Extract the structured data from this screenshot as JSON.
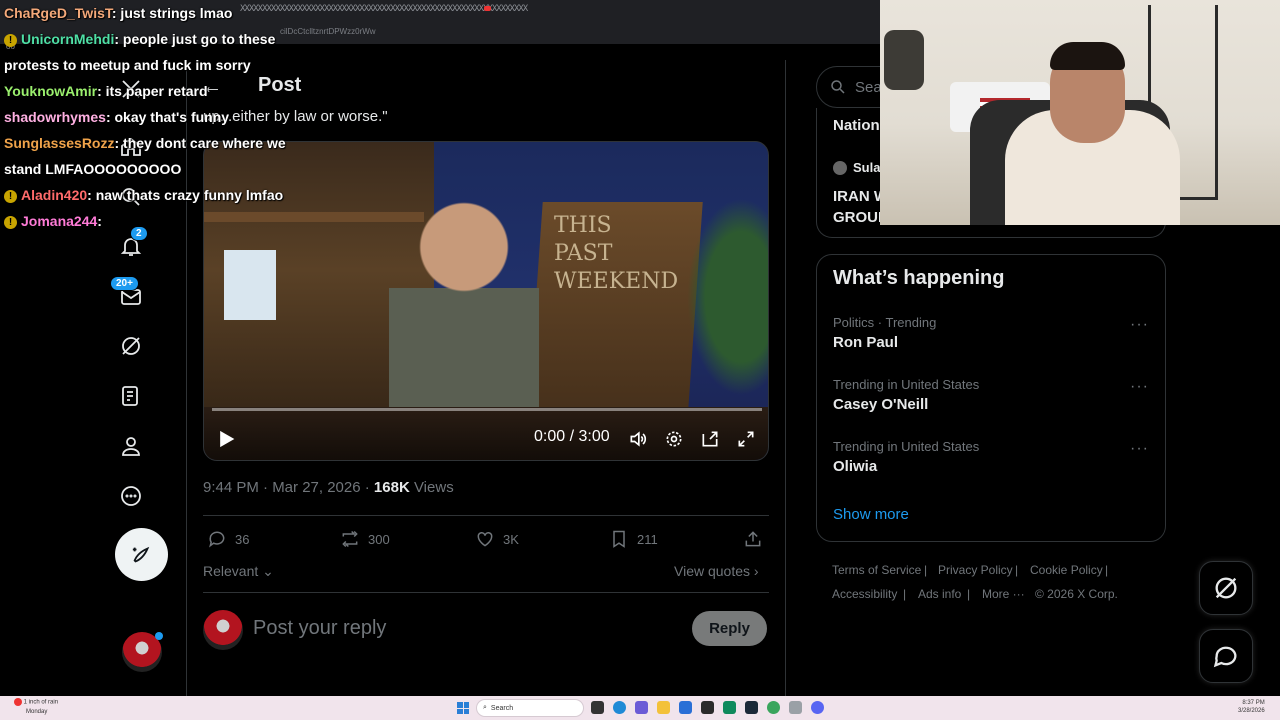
{
  "browser": {
    "tab_strip": "XXXXXXXXXXXXXXXXXXXXXXXXXXXXXXXXXXXXXXXXXXXXXXXXXXXXXXXXXXXXXXXXX",
    "url_fragment": "cilDcCtclltznrtDPWzz0rWw",
    "dots": "oo"
  },
  "nav": {
    "notifications_badge": "2",
    "messages_badge": "20+"
  },
  "header": {
    "back": "←",
    "title": "Post"
  },
  "post": {
    "quote_text": "up...either by law or worse.\"",
    "video": {
      "sign_line1": "THIS",
      "sign_line2": "PAST",
      "sign_line3": "WEEKEND",
      "timecode": "0:00 / 3:00"
    },
    "time": "9:44 PM · Mar 27, 2026 ·",
    "views_count": "168K",
    "views_label": "Views",
    "replies": "36",
    "reposts": "300",
    "likes": "3K",
    "bookmarks": "211",
    "sort_label": "Relevant",
    "view_quotes": "View quotes"
  },
  "reply": {
    "placeholder": "Post your reply",
    "button": "Reply"
  },
  "sidebar": {
    "search_placeholder": "Sear",
    "fragment_top": "Nation",
    "fragment_user": "Sula",
    "fragment_headline": "IRAN W GROUI",
    "happening_title": "What’s happening",
    "trends": [
      {
        "context": "Politics · Trending",
        "name": "Ron Paul"
      },
      {
        "context": "Trending in United States",
        "name": "Casey O'Neill"
      },
      {
        "context": "Trending in United States",
        "name": "Oliwia"
      }
    ],
    "more_glyph": "···",
    "show_more": "Show more",
    "footer": {
      "terms": "Terms of Service",
      "privacy": "Privacy Policy",
      "cookie": "Cookie Policy",
      "accessibility": "Accessibility",
      "ads": "Ads info",
      "more": "More ···",
      "copyright": "© 2026 X Corp.",
      "divider": "|"
    }
  },
  "chat": [
    {
      "user": "ChaRgeD_TwisT",
      "color": "#f4a97a",
      "msg": ": just strings lmao",
      "icon": false
    },
    {
      "user": "UnicornMehdi",
      "color": "#4fe0a6",
      "msg": ": people just go to these",
      "icon": true
    },
    {
      "user": "",
      "color": "#ffffff",
      "msg": "protests to meetup and fuck im sorry",
      "icon": false
    },
    {
      "user": "YouknowAmir",
      "color": "#9bf06e",
      "msg": ": its paper retard",
      "icon": false
    },
    {
      "user": "shadowrhymes",
      "color": "#ffb0e2",
      "msg": ": okay that's funny",
      "icon": false
    },
    {
      "user": "SunglassesRozz",
      "color": "#f0a34a",
      "msg": ": they dont care where we",
      "icon": false
    },
    {
      "user": "",
      "color": "#ffffff",
      "msg": "stand LMFAOOOOOOOOO",
      "icon": false
    },
    {
      "user": "Aladin420",
      "color": "#ff6b6b",
      "msg": ": naw thats crazy funny lmfao",
      "icon": true
    },
    {
      "user": "Jomana244",
      "color": "#ff7bd7",
      "msg": ":",
      "icon": true
    }
  ],
  "taskbar": {
    "weather_line1": "1 inch of rain",
    "weather_line2": "Monday",
    "search": "Search",
    "time": "8:37 PM",
    "date": "3/28/2026"
  },
  "colors": {
    "accent": "#1d9bf0",
    "background": "#000000",
    "border": "#2f3336",
    "muted": "#71767b"
  }
}
